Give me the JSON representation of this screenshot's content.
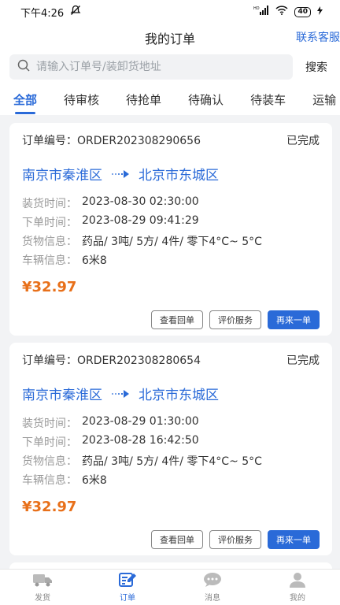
{
  "status_bar": {
    "time": "下午4:26",
    "signal": "HD",
    "battery": "40"
  },
  "header": {
    "title": "我的订单",
    "service": "联系客服"
  },
  "search": {
    "placeholder": "请输入订单号/装卸货地址",
    "button": "搜索"
  },
  "tabs": [
    {
      "label": "全部",
      "active": true
    },
    {
      "label": "待审核"
    },
    {
      "label": "待抢单"
    },
    {
      "label": "待确认"
    },
    {
      "label": "待装车"
    },
    {
      "label": "运输"
    }
  ],
  "orders": [
    {
      "order_label": "订单编号：",
      "order_no": "ORDER202308290656",
      "status": "已完成",
      "from": "南京市秦淮区",
      "to": "北京市东城区",
      "load_label": "装货时间：",
      "load_time": "2023-08-30 02:30:00",
      "order_time_label": "下单时间：",
      "order_time": "2023-08-29 09:41:29",
      "cargo_label": "货物信息：",
      "cargo": "药品/ 3吨/ 5方/ 4件/ 零下4°C~ 5°C",
      "vehicle_label": "车辆信息：",
      "vehicle": "6米8",
      "price": "¥32.97",
      "actions": [
        "查看回单",
        "评价服务",
        "再来一单"
      ]
    },
    {
      "order_label": "订单编号：",
      "order_no": "ORDER202308280654",
      "status": "已完成",
      "from": "南京市秦淮区",
      "to": "北京市东城区",
      "load_label": "装货时间：",
      "load_time": "2023-08-29 01:30:00",
      "order_time_label": "下单时间：",
      "order_time": "2023-08-28 16:42:50",
      "cargo_label": "货物信息：",
      "cargo": "药品/ 3吨/ 5方/ 4件/ 零下4°C~ 5°C",
      "vehicle_label": "车辆信息：",
      "vehicle": "6米8",
      "price": "¥32.97",
      "actions": [
        "查看回单",
        "评价服务",
        "再来一单"
      ]
    }
  ],
  "bottom_nav": [
    {
      "label": "发货",
      "icon": "truck-icon"
    },
    {
      "label": "订单",
      "icon": "order-edit-icon",
      "active": true
    },
    {
      "label": "消息",
      "icon": "chat-bubble-icon"
    },
    {
      "label": "我的",
      "icon": "user-icon"
    }
  ],
  "colors": {
    "accent": "#2a6ad8",
    "price": "#e8701a"
  }
}
